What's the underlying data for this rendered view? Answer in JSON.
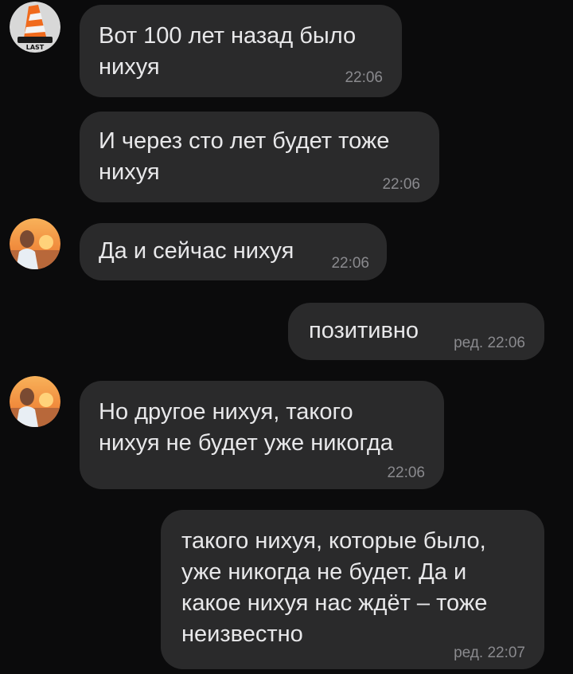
{
  "messages": [
    {
      "side": "in",
      "text": "Вот 100 лет назад было\nнихуя",
      "time": "22:06"
    },
    {
      "side": "in",
      "text": "И через сто лет будет тоже\nнихуя",
      "time": "22:06"
    },
    {
      "side": "in",
      "text": "Да и сейчас нихуя",
      "time": "22:06"
    },
    {
      "side": "out",
      "text": "позитивно",
      "edited": "ред.",
      "time": "22:06"
    },
    {
      "side": "in",
      "text": "Но другое нихуя, такого\nнихуя не будет уже никогда",
      "time": "22:06"
    },
    {
      "side": "out",
      "text": "такого нихуя, которые было,\nуже никогда не будет. Да и\nкакое нихуя нас ждёт – тоже\nнеизвестно",
      "edited": "ред.",
      "time": "22:07"
    }
  ],
  "avatars": {
    "user1": {
      "icon": "traffic-cone-avatar",
      "caption": "LAST"
    },
    "user2": {
      "icon": "sunset-photo-avatar"
    }
  },
  "colors": {
    "background": "#0b0b0c",
    "bubble": "#2a2a2b",
    "text": "#e8e8ea",
    "meta": "#8a8a8e"
  }
}
